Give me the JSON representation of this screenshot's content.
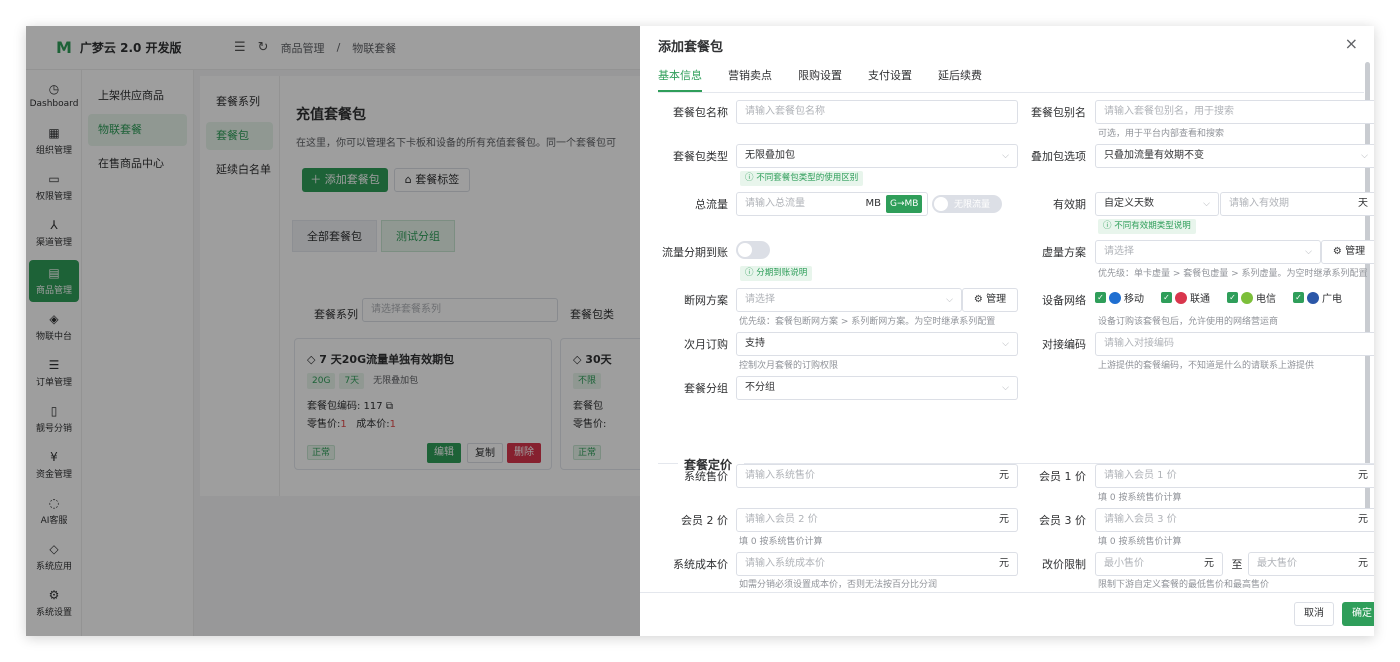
{
  "app": {
    "logo_mark": "M",
    "title": "广梦云 2.0 开发版"
  },
  "breadcrumb": [
    "商品管理",
    "/",
    "物联套餐"
  ],
  "rail": [
    {
      "icon": "◷",
      "label": "Dashboard",
      "active": false
    },
    {
      "icon": "▦",
      "label": "组织管理",
      "active": false
    },
    {
      "icon": "▭",
      "label": "权限管理",
      "active": false
    },
    {
      "icon": "⅄",
      "label": "渠道管理",
      "active": false
    },
    {
      "icon": "▤",
      "label": "商品管理",
      "active": true
    },
    {
      "icon": "◈",
      "label": "物联中台",
      "active": false
    },
    {
      "icon": "☰",
      "label": "订单管理",
      "active": false
    },
    {
      "icon": "▯",
      "label": "靓号分销",
      "active": false
    },
    {
      "icon": "¥",
      "label": "资金管理",
      "active": false
    },
    {
      "icon": "◌",
      "label": "AI客服",
      "active": false
    },
    {
      "icon": "◇",
      "label": "系统应用",
      "active": false
    },
    {
      "icon": "⚙",
      "label": "系统设置",
      "active": false
    }
  ],
  "subnav": [
    {
      "label": "上架供应商品",
      "active": false
    },
    {
      "label": "物联套餐",
      "active": true
    },
    {
      "label": "在售商品中心",
      "active": false
    }
  ],
  "series_nav": [
    {
      "label": "套餐系列",
      "active": false
    },
    {
      "label": "套餐包",
      "active": true
    },
    {
      "label": "延续白名单",
      "active": false
    }
  ],
  "page": {
    "title": "充值套餐包",
    "description": "在这里，你可以管理名下卡板和设备的所有充值套餐包。同一个套餐包可",
    "add_button": "添加套餐包",
    "tag_button": "套餐标签",
    "tabs": [
      {
        "label": "全部套餐包",
        "active": false
      },
      {
        "label": "测试分组",
        "active": true
      }
    ],
    "filter_label": "套餐系列",
    "filter_placeholder": "请选择套餐系列",
    "filter_label2": "套餐包类"
  },
  "cards": [
    {
      "title": "7 天20G流量单独有效期包",
      "chips": [
        "20G",
        "7天",
        "无限叠加包"
      ],
      "code_label": "套餐包编码: 117",
      "retail_label": "零售价:",
      "retail_value": "1",
      "cost_label": "成本价:",
      "cost_value": "1",
      "status": "正常",
      "edit": "编辑",
      "copy": "复制",
      "delete": "删除"
    },
    {
      "title": "30天",
      "chips": [
        "不限"
      ],
      "code_label": "套餐包",
      "retail_label": "零售价:",
      "retail_value": "",
      "cost_label": "",
      "cost_value": "",
      "status": "正常"
    }
  ],
  "drawer": {
    "title": "添加套餐包",
    "close": "×",
    "tabs": [
      {
        "label": "基本信息",
        "active": true
      },
      {
        "label": "营销卖点",
        "active": false
      },
      {
        "label": "限购设置",
        "active": false
      },
      {
        "label": "支付设置",
        "active": false
      },
      {
        "label": "延后续费",
        "active": false
      }
    ],
    "fields": {
      "name": {
        "label": "套餐包名称",
        "placeholder": "请输入套餐包名称"
      },
      "alias": {
        "label": "套餐包别名",
        "placeholder": "请输入套餐包别名，用于搜索",
        "hint": "可选，用于平台内部查看和搜索"
      },
      "type": {
        "label": "套餐包类型",
        "value": "无限叠加包",
        "hint": "不同套餐包类型的使用区别"
      },
      "stack": {
        "label": "叠加包选项",
        "value": "只叠加流量有效期不变"
      },
      "traffic": {
        "label": "总流量",
        "placeholder": "请输入总流量",
        "unit": "MB",
        "unit_button": "G→MB",
        "switch_text": "无限流量"
      },
      "validity": {
        "label": "有效期",
        "value": "自定义天数",
        "placeholder": "请输入有效期",
        "unit": "天",
        "hint": "不同有效期类型说明"
      },
      "installment": {
        "label": "流量分期到账",
        "hint": "分期到账说明"
      },
      "virtual": {
        "label": "虚量方案",
        "placeholder": "请选择",
        "manage": "管理",
        "hint": "优先级：单卡虚量 > 套餐包虚量 > 系列虚量。为空时继承系列配置"
      },
      "cutoff": {
        "label": "断网方案",
        "placeholder": "请选择",
        "manage": "管理",
        "hint": "优先级：套餐包断网方案 > 系列断网方案。为空时继承系列配置"
      },
      "network": {
        "label": "设备网络",
        "options": [
          "移动",
          "联通",
          "电信",
          "广电"
        ],
        "hint": "设备订购该套餐包后，允许使用的网络营运商"
      },
      "next_month": {
        "label": "次月订购",
        "value": "支持",
        "hint": "控制次月套餐的订购权限"
      },
      "dock_code": {
        "label": "对接编码",
        "placeholder": "请输入对接编码",
        "hint": "上游提供的套餐编码，不知道是什么的请联系上游提供"
      },
      "group": {
        "label": "套餐分组",
        "value": "不分组"
      }
    },
    "pricing": {
      "section_title": "套餐定价",
      "currency": "元",
      "system_price": {
        "label": "系统售价",
        "placeholder": "请输入系统售价"
      },
      "member1": {
        "label": "会员 1 价",
        "placeholder": "请输入会员 1 价",
        "hint": "填 0 按系统售价计算"
      },
      "member2": {
        "label": "会员 2 价",
        "placeholder": "请输入会员 2 价",
        "hint": "填 0 按系统售价计算"
      },
      "member3": {
        "label": "会员 3 价",
        "placeholder": "请输入会员 3 价",
        "hint": "填 0 按系统售价计算"
      },
      "cost": {
        "label": "系统成本价",
        "placeholder": "请输入系统成本价",
        "hint": "如需分销必须设置成本价，否则无法按百分比分润"
      },
      "limit": {
        "label": "改价限制",
        "min_placeholder": "最小售价",
        "max_placeholder": "最大售价",
        "to": "至",
        "hint": "限制下游自定义套餐的最低售价和最高售价"
      }
    },
    "footer": {
      "cancel": "取消",
      "confirm": "确定"
    }
  },
  "colors": {
    "accent": "#2f9e5a",
    "danger": "#d9364d"
  }
}
